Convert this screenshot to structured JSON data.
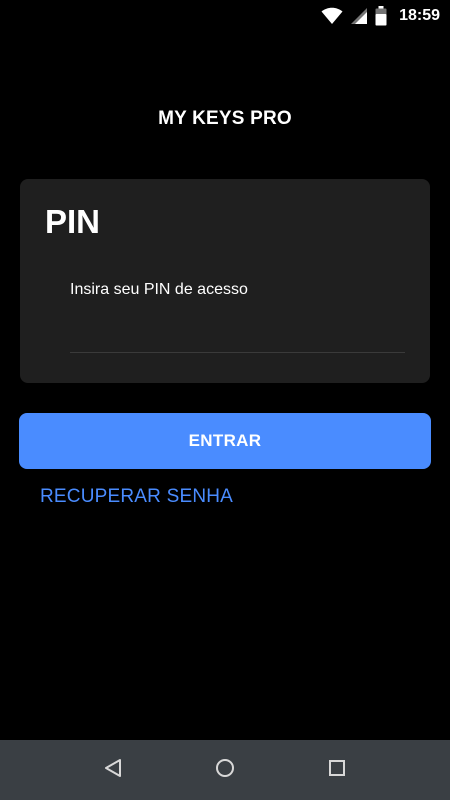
{
  "status_bar": {
    "time": "18:59",
    "icons": [
      "wifi-icon",
      "cellular-signal-icon",
      "battery-icon"
    ]
  },
  "app": {
    "title": "MY KEYS PRO"
  },
  "pin_card": {
    "title": "PIN",
    "field_label": "Insira seu PIN de acesso",
    "field_value": ""
  },
  "actions": {
    "enter_label": "ENTRAR",
    "recover_label": "RECUPERAR SENHA"
  },
  "nav_bar": {
    "icons": [
      "back-icon",
      "home-icon",
      "recents-icon"
    ]
  },
  "colors": {
    "background": "#000000",
    "card": "#1f1f1f",
    "accent": "#4a8cff",
    "nav_bar": "#3a3f44",
    "text": "#ffffff"
  }
}
